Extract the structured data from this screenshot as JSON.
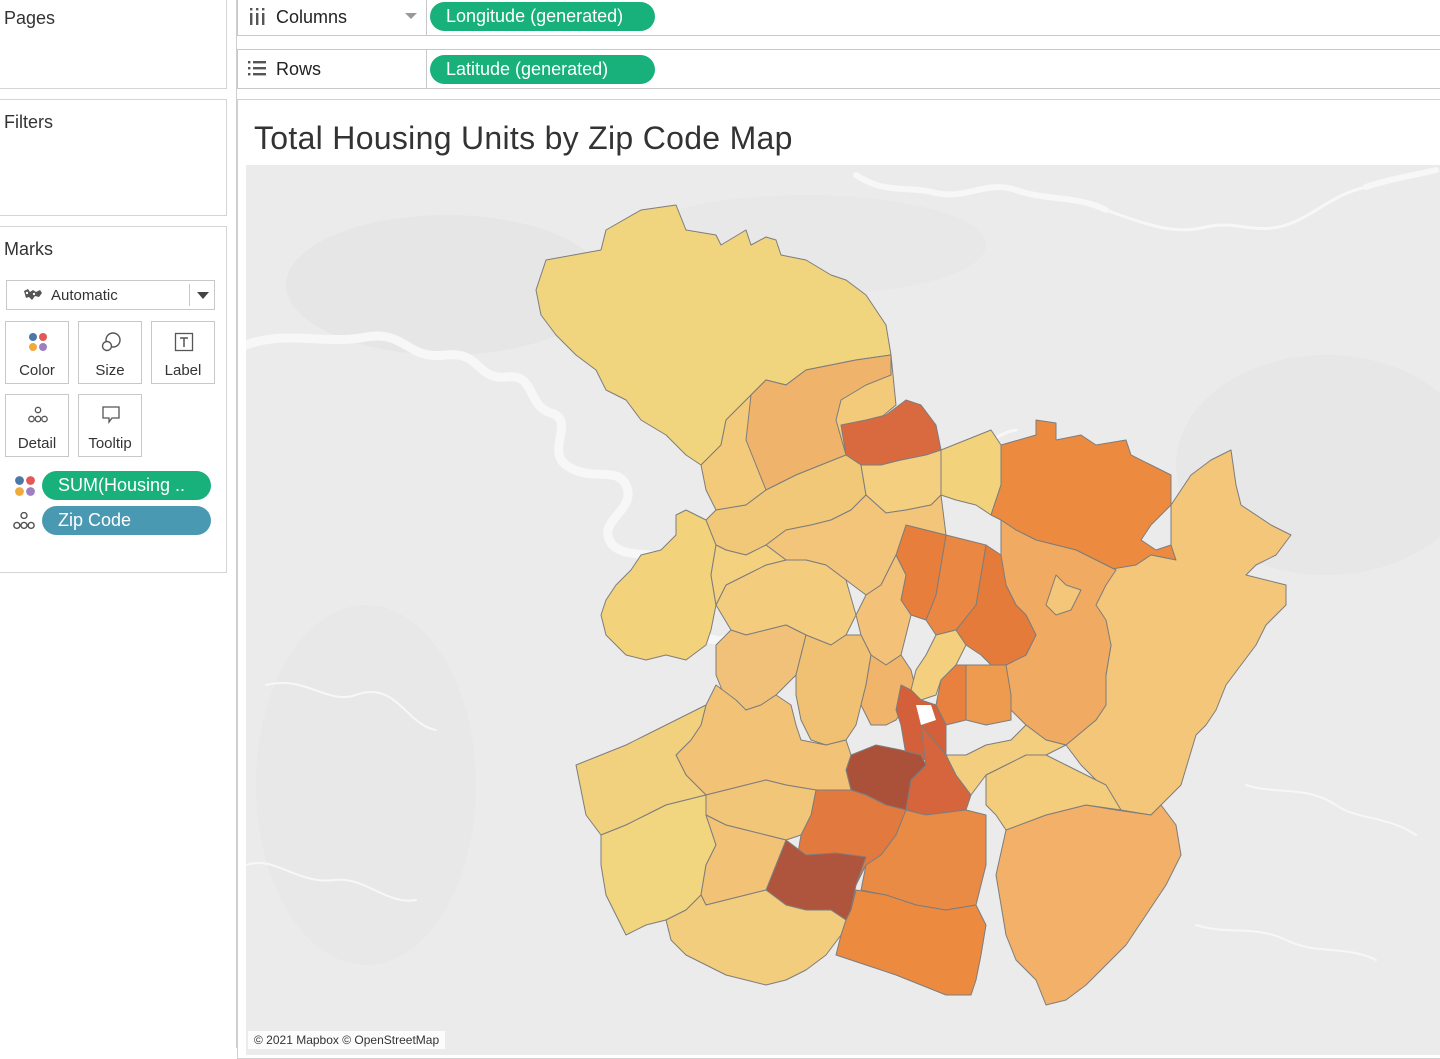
{
  "shelves": {
    "pages": {
      "title": "Pages"
    },
    "filters": {
      "title": "Filters"
    },
    "columns": {
      "label": "Columns",
      "pill": "Longitude (generated)"
    },
    "rows": {
      "label": "Rows",
      "pill": "Latitude (generated)"
    }
  },
  "marks": {
    "title": "Marks",
    "type": "Automatic",
    "buttons": {
      "color": "Color",
      "size": "Size",
      "label": "Label",
      "detail": "Detail",
      "tooltip": "Tooltip"
    },
    "fields": {
      "color_field": "SUM(Housing ..",
      "detail_field": "Zip Code"
    }
  },
  "view": {
    "title": "Total Housing Units by Zip Code Map",
    "attribution": "© 2021 Mapbox © OpenStreetMap"
  },
  "colors": {
    "dimension_pill": "#18b07b",
    "detail_pill": "#4a99b3",
    "map_background": "#ebebeb",
    "scale_low": "#f0d47c",
    "scale_mid": "#ec8c3e",
    "scale_high": "#a9503b"
  }
}
